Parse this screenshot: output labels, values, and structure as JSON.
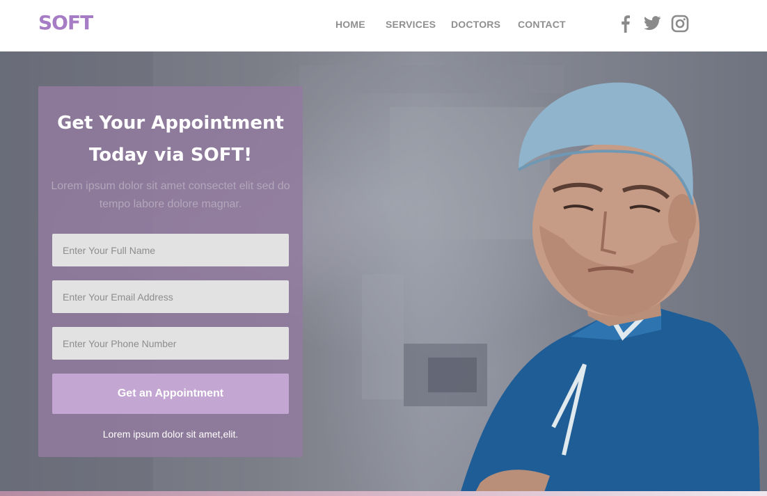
{
  "brand": {
    "logo_text": "SOFT",
    "accent_color": "#a67cc4"
  },
  "nav": {
    "items": [
      {
        "label": "HOME"
      },
      {
        "label": "SERVICES"
      },
      {
        "label": "DOCTORS"
      },
      {
        "label": "CONTACT"
      }
    ]
  },
  "social": {
    "icons": [
      "facebook-icon",
      "twitter-icon",
      "instagram-icon"
    ]
  },
  "hero": {
    "image": "surgeon-in-scrubs",
    "form": {
      "title_line1": "Get Your Appointment",
      "title_line2": "Today via SOFT!",
      "subtitle": "Lorem ipsum dolor sit amet consectet elit sed do tempo labore dolore magnar.",
      "name_placeholder": "Enter Your Full Name",
      "email_placeholder": "Enter Your Email Address",
      "phone_placeholder": "Enter Your Phone Number",
      "submit_label": "Get an Appointment",
      "footnote": "Lorem ipsum dolor sit amet,elit.",
      "button_color": "#c3a6d1",
      "card_color": "#927a9e"
    }
  }
}
